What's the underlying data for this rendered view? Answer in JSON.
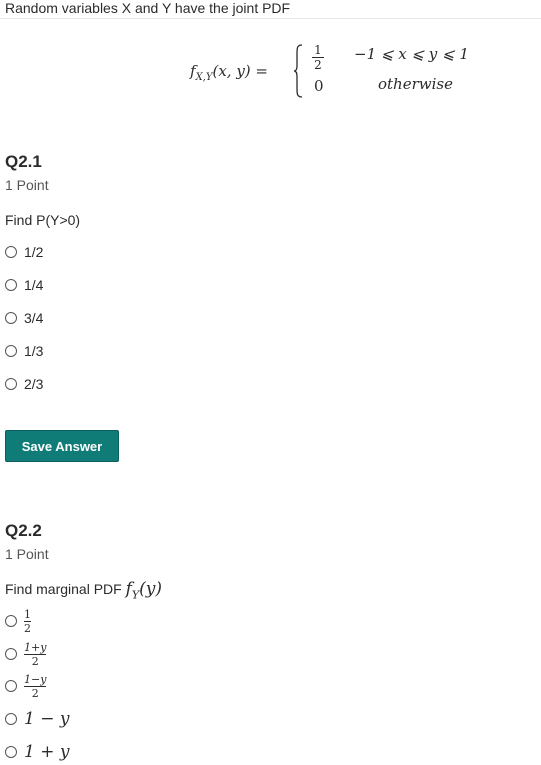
{
  "intro": "Random variables X and Y have the joint PDF",
  "pdf": {
    "lhs": "f_{X,Y}(x, y) =",
    "case1_value_num": "1",
    "case1_value_den": "2",
    "case1_cond": "−1 ⩽ x ⩽ y ⩽ 1",
    "case2_value": "0",
    "case2_cond": "otherwise"
  },
  "q1": {
    "title": "Q2.1",
    "points": "1 Point",
    "prompt": "Find P(Y>0)",
    "options": [
      "1/2",
      "1/4",
      "3/4",
      "1/3",
      "2/3"
    ]
  },
  "save_button": "Save Answer",
  "q2": {
    "title": "Q2.2",
    "points": "1 Point",
    "prompt_text": "Find marginal PDF ",
    "prompt_math": "f_Y(y)",
    "options": [
      {
        "num": "1",
        "den": "2"
      },
      {
        "num": "1+y",
        "den": "2"
      },
      {
        "num": "1−y",
        "den": "2"
      },
      {
        "text": "1 − y"
      },
      {
        "text": "1 + y"
      }
    ]
  }
}
